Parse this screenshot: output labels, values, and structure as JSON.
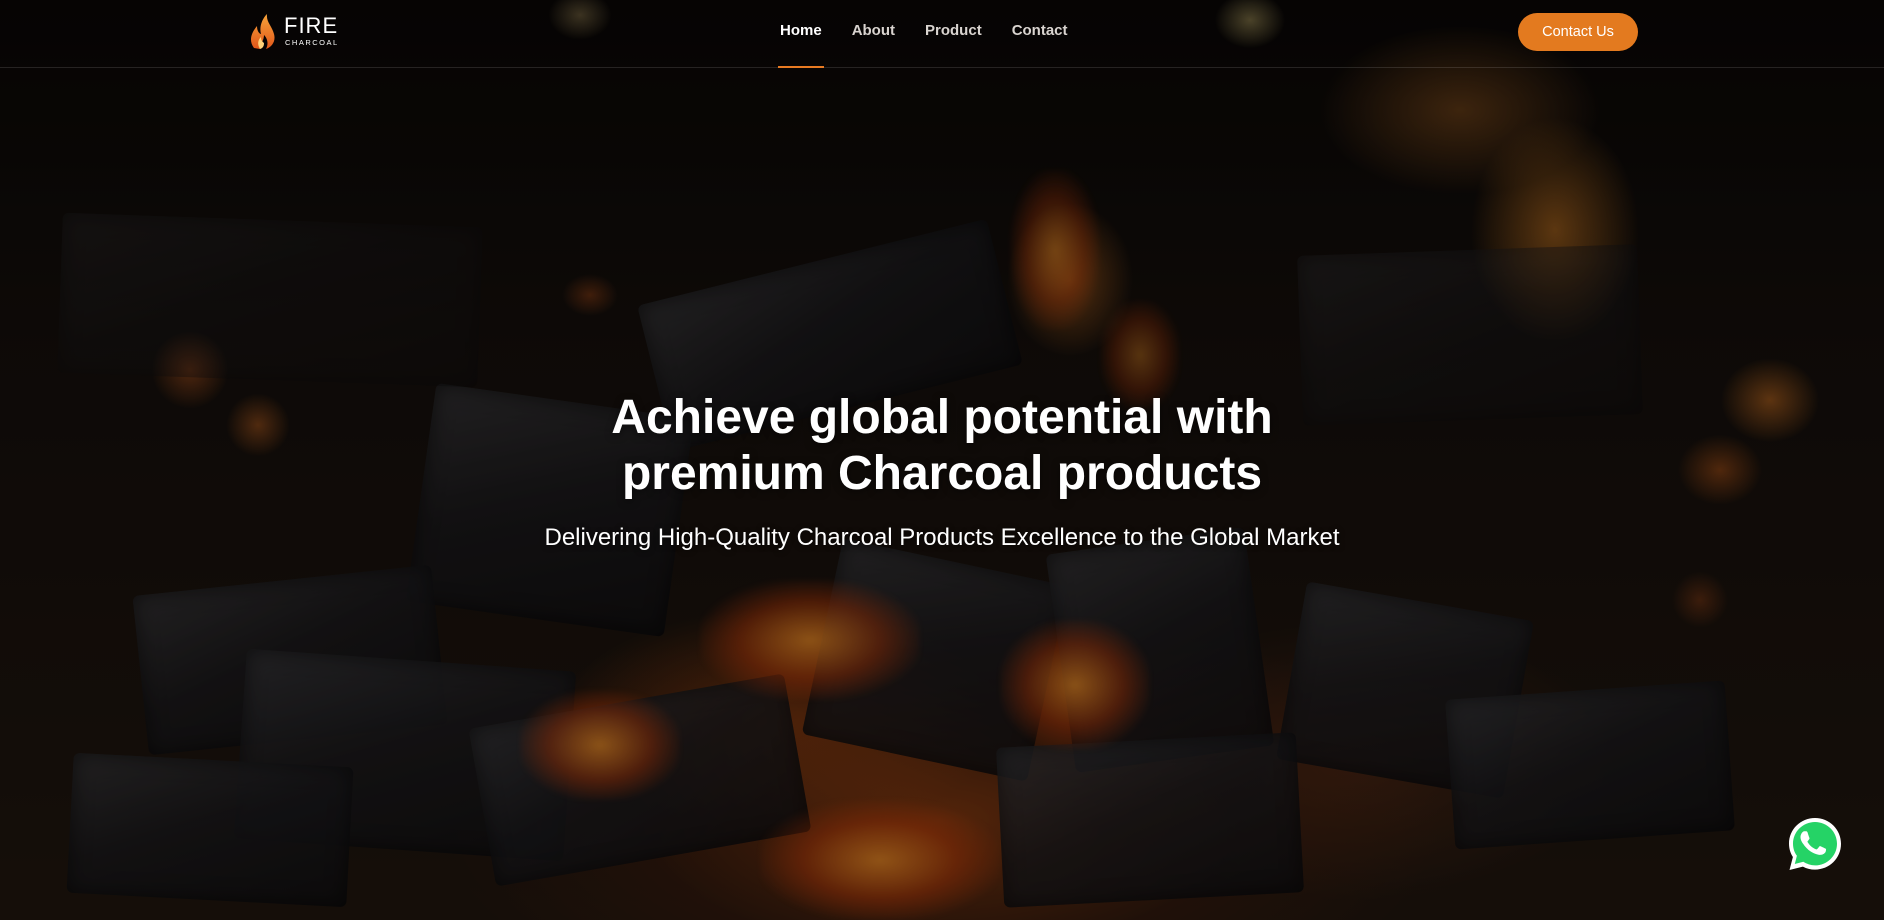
{
  "brand": {
    "name_top": "FIRE",
    "name_bottom": "CHARCOAL",
    "logo_icon": "flame-icon",
    "accent_color": "#e37a1f"
  },
  "nav": {
    "items": [
      {
        "label": "Home",
        "active": true
      },
      {
        "label": "About",
        "active": false
      },
      {
        "label": "Product",
        "active": false
      },
      {
        "label": "Contact",
        "active": false
      }
    ]
  },
  "header": {
    "cta_label": "Contact Us"
  },
  "hero": {
    "title_line1": "Achieve global potential with",
    "title_line2": "premium Charcoal products",
    "subtitle": "Delivering High-Quality Charcoal Products Excellence to the Global Market",
    "background": "charcoal fire photo"
  },
  "floating": {
    "whatsapp_icon": "whatsapp-icon",
    "whatsapp_color": "#25d366"
  }
}
